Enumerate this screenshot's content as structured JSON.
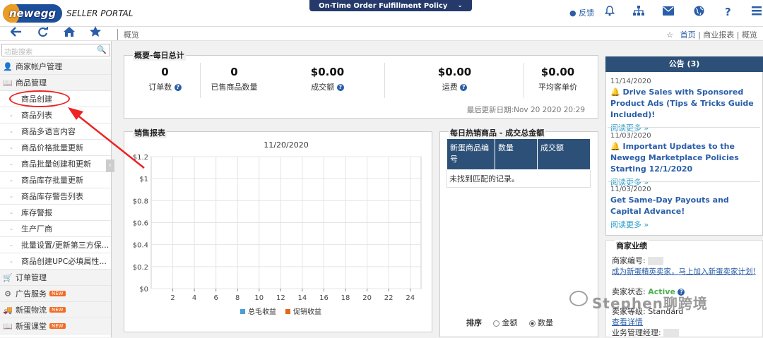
{
  "header": {
    "logo_text": "newegg",
    "portal_text": "SELLER PORTAL",
    "policy_label": "On-Time Order Fulfillment Policy",
    "feedback": "反馈",
    "icons": [
      "bell-icon",
      "sitemap-icon",
      "mail-icon",
      "globe-icon",
      "help-icon",
      "menu-icon"
    ]
  },
  "nav": {
    "page_title": "概览",
    "breadcrumb": {
      "home": "首页",
      "sep1": " | ",
      "reports": "商业报表",
      "sep2": " | ",
      "current": "概览"
    }
  },
  "sidebar": {
    "search_placeholder": "功能搜索",
    "items": [
      {
        "label": "商家帐户管理",
        "icon": "user-icon",
        "level": "top"
      },
      {
        "label": "商品管理",
        "icon": "book-icon",
        "level": "top"
      },
      {
        "label": "商品创建",
        "level": "sub"
      },
      {
        "label": "商品列表",
        "level": "sub"
      },
      {
        "label": "商品多语言内容",
        "level": "sub"
      },
      {
        "label": "商品价格批量更新",
        "level": "sub"
      },
      {
        "label": "商品批量创建和更新",
        "level": "sub"
      },
      {
        "label": "商品库存批量更新",
        "level": "sub"
      },
      {
        "label": "商品库存警告列表",
        "level": "sub"
      },
      {
        "label": "库存警报",
        "level": "sub"
      },
      {
        "label": "生产厂商",
        "level": "sub"
      },
      {
        "label": "批量设置/更新第三方保...",
        "level": "sub"
      },
      {
        "label": "商品创建UPC必填属性...",
        "level": "sub"
      },
      {
        "label": "订单管理",
        "icon": "cart-icon",
        "level": "top"
      },
      {
        "label": "广告服务",
        "icon": "gears-icon",
        "level": "top",
        "badge": "NEW"
      },
      {
        "label": "新蛋物流",
        "icon": "truck-icon",
        "level": "top",
        "badge": "NEW"
      },
      {
        "label": "新蛋课堂",
        "icon": "book-icon",
        "level": "top",
        "badge": "NEW"
      }
    ]
  },
  "summary": {
    "title": "概要-每日总计",
    "stats": [
      {
        "value": "0",
        "label": "订单数"
      },
      {
        "value": "0",
        "label": "已售商品数量"
      },
      {
        "value": "$0.00",
        "label": "成交额"
      },
      {
        "value": "$0.00",
        "label": "运费"
      },
      {
        "value": "$0.00",
        "label": "平均客单价"
      }
    ],
    "last_updated": "最后更新日期:Nov 20 2020 20:29"
  },
  "sales_report": {
    "title": "销售报表",
    "date": "11/20/2020",
    "legend": [
      {
        "label": "总毛收益",
        "color": "#4a9fd4"
      },
      {
        "label": "促销收益",
        "color": "#e06a1b"
      }
    ]
  },
  "chart_data": {
    "type": "line",
    "title": "11/20/2020",
    "x": [
      2,
      4,
      6,
      8,
      10,
      12,
      14,
      16,
      18,
      20,
      22,
      24
    ],
    "xlim": [
      0,
      25
    ],
    "ylim": [
      0,
      1.2
    ],
    "yticks": [
      "$0",
      "$0.2",
      "$0.4",
      "$0.6",
      "$0.8",
      "$1",
      "$1.2"
    ],
    "xticks": [
      "2",
      "4",
      "6",
      "8",
      "10",
      "12",
      "14",
      "16",
      "18",
      "20",
      "22",
      "24"
    ],
    "series": [
      {
        "name": "总毛收益",
        "values": []
      },
      {
        "name": "促销收益",
        "values": []
      }
    ],
    "grid": true,
    "legend_position": "bottom"
  },
  "hot_products": {
    "title": "每日热销商品 - 成交总金额",
    "headers": [
      "新蛋商品编号",
      "数量",
      "成交额"
    ],
    "empty_text": "未找到匹配的记录。",
    "sort_label": "排序",
    "sort_options": [
      {
        "label": "金额",
        "checked": false
      },
      {
        "label": "数量",
        "checked": true
      }
    ]
  },
  "announcements": {
    "title": "公告 (3)",
    "items": [
      {
        "date": "11/14/2020",
        "title": "Drive Sales with Sponsored Product Ads (Tips & Tricks Guide Included)!",
        "more": "阅读更多 »"
      },
      {
        "date": "11/03/2020",
        "title": "Important Updates to the Newegg Marketplace Policies Starting 12/1/2020",
        "more": "阅读更多 »"
      },
      {
        "date": "11/03/2020",
        "title": "Get Same-Day Payouts and Capital Advance!",
        "more": "阅读更多 »"
      }
    ]
  },
  "performance": {
    "title": "商家业绩",
    "id_label": "商家编号:",
    "join_link": "成为新蛋精英卖家，马上加入新蛋卖家计划!",
    "status_label": "卖家状态:",
    "status_value": "Active",
    "level_label": "卖家等级:",
    "level_value": "Standard",
    "details_link": "查看详情",
    "manager_label": "业务管理经理:"
  },
  "watermark": "Stephen聊跨境"
}
